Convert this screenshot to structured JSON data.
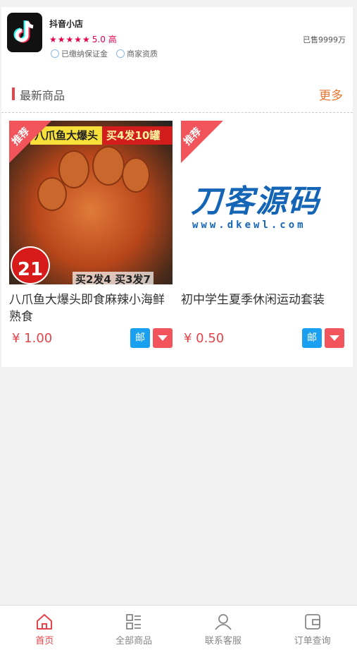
{
  "shop": {
    "name": "抖音小店",
    "stars": "★★★★★",
    "score": "5.0 高",
    "sold": "已售9999万",
    "tags": [
      "已缴纳保证金",
      "商家资质"
    ]
  },
  "section": {
    "title": "最新商品",
    "more": "更多"
  },
  "products": [
    {
      "badge": "推荐",
      "image_banner_a": "八爪鱼大爆头",
      "image_banner_b": "买4发10罐",
      "image_price": "21",
      "image_promo": "买2发4 买3发7",
      "title": "八爪鱼大爆头即食麻辣小海鲜熟食",
      "price": "¥ 1.00",
      "mail_label": "邮"
    },
    {
      "badge": "推荐",
      "image_logo": "刀客源码",
      "image_url": "www.dkewl.com",
      "title": "初中学生夏季休闲运动套装",
      "price": "¥ 0.50",
      "mail_label": "邮"
    }
  ],
  "tabbar": [
    {
      "label": "首页",
      "icon": "home-icon",
      "active": true
    },
    {
      "label": "全部商品",
      "icon": "list-icon",
      "active": false
    },
    {
      "label": "联系客服",
      "icon": "user-icon",
      "active": false
    },
    {
      "label": "订单查询",
      "icon": "wallet-icon",
      "active": false
    }
  ],
  "colors": {
    "accent": "#e6434b",
    "more": "#e8742f",
    "mail": "#1aa0f0",
    "star": "#e6004c"
  }
}
